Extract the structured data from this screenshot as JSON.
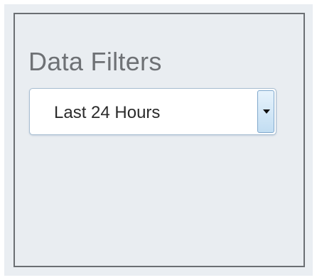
{
  "panel": {
    "title": "Data Filters",
    "filter": {
      "selected": "Last 24 Hours",
      "icon": "chevron-down-icon"
    }
  }
}
